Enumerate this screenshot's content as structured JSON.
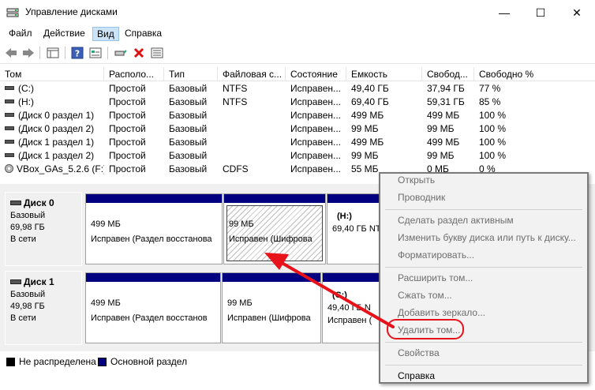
{
  "window": {
    "title": "Управление дисками",
    "controls": [
      "—",
      "☐",
      "✕"
    ]
  },
  "menu": [
    "Файл",
    "Действие",
    "Вид",
    "Справка"
  ],
  "volumes": {
    "columns": [
      "Том",
      "Располо...",
      "Тип",
      "Файловая с...",
      "Состояние",
      "Емкость",
      "Свобод...",
      "Свободно %"
    ],
    "rows": [
      [
        "(C:)",
        "Простой",
        "Базовый",
        "NTFS",
        "Исправен...",
        "49,40 ГБ",
        "37,94 ГБ",
        "77 %"
      ],
      [
        "(H:)",
        "Простой",
        "Базовый",
        "NTFS",
        "Исправен...",
        "69,40 ГБ",
        "59,31 ГБ",
        "85 %"
      ],
      [
        "(Диск 0 раздел 1)",
        "Простой",
        "Базовый",
        "",
        "Исправен...",
        "499 МБ",
        "499 МБ",
        "100 %"
      ],
      [
        "(Диск 0 раздел 2)",
        "Простой",
        "Базовый",
        "",
        "Исправен...",
        "99 МБ",
        "99 МБ",
        "100 %"
      ],
      [
        "(Диск 1 раздел 1)",
        "Простой",
        "Базовый",
        "",
        "Исправен...",
        "499 МБ",
        "499 МБ",
        "100 %"
      ],
      [
        "(Диск 1 раздел 2)",
        "Простой",
        "Базовый",
        "",
        "Исправен...",
        "99 МБ",
        "99 МБ",
        "100 %"
      ],
      [
        "VBox_GAs_5.2.6 (F:)",
        "Простой",
        "Базовый",
        "CDFS",
        "Исправен...",
        "55 МБ",
        "0 МБ",
        "0 %"
      ]
    ]
  },
  "disks": [
    {
      "name": "Диск 0",
      "type": "Базовый",
      "size": "69,98 ГБ",
      "status": "В сети",
      "partitions": [
        {
          "line1": "499 МБ",
          "line2": "Исправен (Раздел восстанова"
        },
        {
          "line1": "99 МБ",
          "line2": "Исправен (Шифрова"
        },
        {
          "line0": "(H:)",
          "line1": "69,40 ГБ NT",
          "line2": ""
        }
      ]
    },
    {
      "name": "Диск 1",
      "type": "Базовый",
      "size": "49,98 ГБ",
      "status": "В сети",
      "partitions": [
        {
          "line1": "499 МБ",
          "line2": "Исправен (Раздел восстанов"
        },
        {
          "line1": "99 МБ",
          "line2": "Исправен (Шифрова"
        },
        {
          "line0": "(C:)",
          "line1": "49,40 ГБ N",
          "line2": "Исправен ("
        }
      ]
    }
  ],
  "legend": [
    {
      "label": "Не распределена",
      "color": "#000000"
    },
    {
      "label": "Основной раздел",
      "color": "#000080"
    }
  ],
  "context_menu": [
    {
      "label": "Открыть",
      "enabled": false
    },
    {
      "label": "Проводник",
      "enabled": false
    },
    {
      "label": "Сделать раздел активным",
      "enabled": false
    },
    {
      "label": "Изменить букву диска или путь к диску...",
      "enabled": false
    },
    {
      "label": "Форматировать...",
      "enabled": false
    },
    {
      "label": "Расширить том...",
      "enabled": false
    },
    {
      "label": "Сжать том...",
      "enabled": false
    },
    {
      "label": "Добавить зеркало...",
      "enabled": false
    },
    {
      "label": "Удалить том...",
      "enabled": false
    },
    {
      "label": "Свойства",
      "enabled": false
    },
    {
      "label": "Справка",
      "enabled": true
    }
  ],
  "colors": {
    "primary_partition": "#000080",
    "annotation": "#e8121b",
    "selection": "#cce4f7"
  }
}
